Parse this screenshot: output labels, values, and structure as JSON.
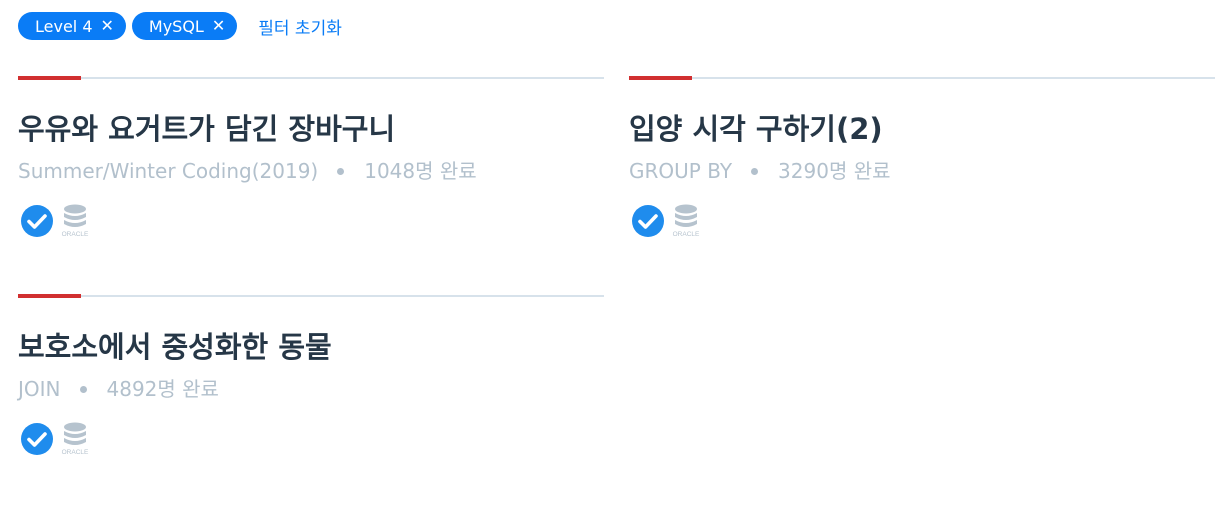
{
  "filters": {
    "chips": [
      {
        "label": "Level 4"
      },
      {
        "label": "MySQL"
      }
    ],
    "reset_label": "필터 초기화",
    "chip_color": "#0a7cf6"
  },
  "cards": [
    {
      "title": "우유와 요거트가 담긴 장바구니",
      "category": "Summer/Winter Coding(2019)",
      "completed": "1048명 완료",
      "icons": [
        "check-icon",
        "oracle-database-icon"
      ]
    },
    {
      "title": "입양 시각 구하기(2)",
      "category": "GROUP BY",
      "completed": "3290명 완료",
      "icons": [
        "check-icon",
        "oracle-database-icon"
      ]
    },
    {
      "title": "보호소에서 중성화한 동물",
      "category": "JOIN",
      "completed": "4892명 완료",
      "icons": [
        "check-icon",
        "oracle-database-icon"
      ]
    }
  ],
  "oracle_label": "ORACLE",
  "colors": {
    "accent": "#d12f30",
    "divider": "#d7e2eb",
    "title": "#263747",
    "meta": "#b2c0cc",
    "check": "#1f8ced"
  }
}
